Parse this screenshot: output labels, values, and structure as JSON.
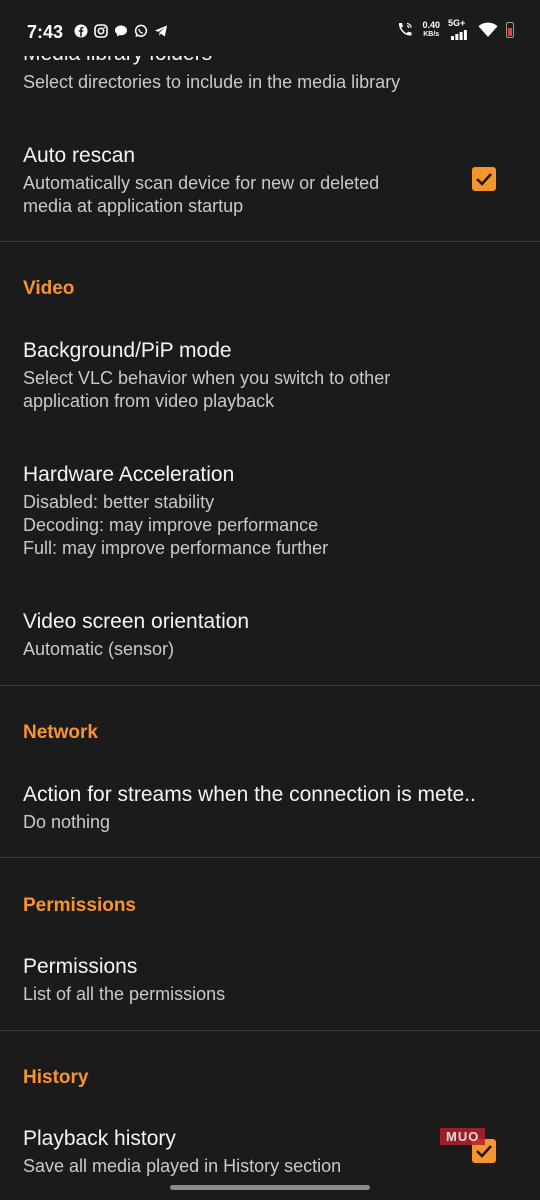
{
  "status_bar": {
    "time": "7:43",
    "speed_value": "0.40",
    "speed_unit": "KB/s",
    "network": "5G+"
  },
  "media_library": {
    "title": "Media library folders",
    "subtitle": "Select directories to include in the media library"
  },
  "auto_rescan": {
    "title": "Auto rescan",
    "subtitle": "Automatically scan device for new or deleted\nmedia at application startup",
    "checked": true
  },
  "video": {
    "header": "Video",
    "background_pip": {
      "title": "Background/PiP mode",
      "subtitle": "Select VLC behavior when you switch to other\napplication from video playback"
    },
    "hardware_acceleration": {
      "title": "Hardware Acceleration",
      "subtitle": "Disabled: better stability\nDecoding: may improve performance\nFull: may improve performance further"
    },
    "orientation": {
      "title": "Video screen orientation",
      "subtitle": "Automatic (sensor)"
    }
  },
  "network": {
    "header": "Network",
    "metered": {
      "title": "Action for streams when the connection is mete..",
      "subtitle": "Do nothing"
    }
  },
  "permissions": {
    "header": "Permissions",
    "item": {
      "title": "Permissions",
      "subtitle": "List of all the permissions"
    }
  },
  "history": {
    "header": "History",
    "playback": {
      "title": "Playback history",
      "subtitle": "Save all media played in History section",
      "checked": true
    }
  },
  "watermark": "MUO",
  "colors": {
    "accent": "#f7942e",
    "background": "#1c1b1b",
    "divider": "#3a3939"
  },
  "icons": [
    "facebook-icon",
    "instagram-icon",
    "chat-icon",
    "whatsapp-icon",
    "telegram-icon",
    "wifi-call-icon",
    "signal-icon",
    "wifi-icon",
    "battery-icon"
  ]
}
